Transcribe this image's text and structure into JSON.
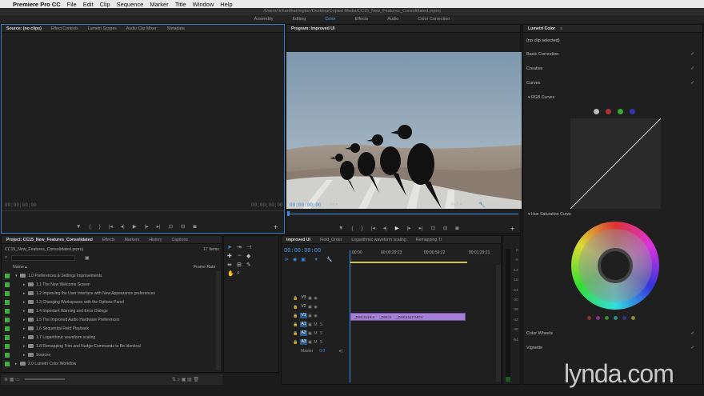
{
  "menubar": {
    "app": "Premiere Pro CC",
    "items": [
      "File",
      "Edit",
      "Clip",
      "Sequence",
      "Marker",
      "Title",
      "Window",
      "Help"
    ]
  },
  "title_path": "/Users/richardharrington/Desktop/Copied Media/CC15_New_Features_Consolidated.prproj",
  "workspaces": [
    "Assembly",
    "Editing",
    "Color",
    "Effects",
    "Audio",
    "Color Correction"
  ],
  "workspace_active": "Color",
  "source": {
    "tabs": [
      "Source: (no clips)",
      "Effect Controls",
      "Lumetri Scopes",
      "Audio Clip Mixer:",
      "Metadata"
    ],
    "tc_left": "00;00;00;00",
    "tc_right": "00;00;00;00"
  },
  "program": {
    "title": "Program: Improved UI",
    "tc_left": "00:00:00:00",
    "fit": "Fit",
    "quality": "Full",
    "tc_right": "00:01:19:22"
  },
  "lumetri": {
    "title": "Lumetri Color",
    "no_clip": "(no clip selected)",
    "basic": "Basic Correction",
    "creative": "Creative",
    "curves": "Curves",
    "rgb_curves": "RGB Curves",
    "hue_sat": "Hue Saturation Curve",
    "color_wheels": "Color Wheels",
    "vignette": "Vignette"
  },
  "project": {
    "tabs": [
      "Project: CC15_New_Features_Consolidated",
      "Effects",
      "Markers",
      "History",
      "Captions"
    ],
    "file": "CC15_New_Features_Consolidated.prproj",
    "count": "17 Items",
    "col_name": "Name",
    "col_fps": "Frame Rate",
    "items": [
      {
        "label": "1.0 Preferences & Settings Improvements",
        "level": 1
      },
      {
        "label": "1.1 The New Welcome Screen",
        "level": 2
      },
      {
        "label": "1.2 Improving the User Interface with New Appearance preferences",
        "level": 2
      },
      {
        "label": "1.3 Changing Workspaces with the Options Panel",
        "level": 2
      },
      {
        "label": "1.4 Important Warning and Error Dialogs",
        "level": 2
      },
      {
        "label": "1.5 The Improved Audio Hardware Preferences",
        "level": 2
      },
      {
        "label": "1.6 Sequential Field Playback",
        "level": 2
      },
      {
        "label": "1.7 Logarithmic waveform scaling",
        "level": 2
      },
      {
        "label": "1.8 Remapping Trim and Nudge Commands to Be Identical",
        "level": 2
      },
      {
        "label": "Sources",
        "level": 2
      },
      {
        "label": "2.0 Lumetri Color Workflow",
        "level": 1
      }
    ]
  },
  "timeline": {
    "tabs": [
      "Improved UI",
      "Field_Order",
      "Logarithmic waveform scaling",
      "Remapping Tr"
    ],
    "tc": "00:00:00:00",
    "ruler": [
      "00:00",
      "00:00:29:23",
      "00:00:59:22",
      "00:01:29:21"
    ],
    "tracks": [
      "V3",
      "V2",
      "V1",
      "A1",
      "A2",
      "A3"
    ],
    "master": "Master",
    "master_val": "0.0",
    "clips": [
      "_DSC4116.4",
      "_DSC4",
      "_DSC4117.MOV"
    ]
  },
  "meters": {
    "scale": [
      "0",
      "-6",
      "-12",
      "-18",
      "-24",
      "-30",
      "-36",
      "-42",
      "-48",
      "-54"
    ]
  },
  "watermark": "lynda.com"
}
